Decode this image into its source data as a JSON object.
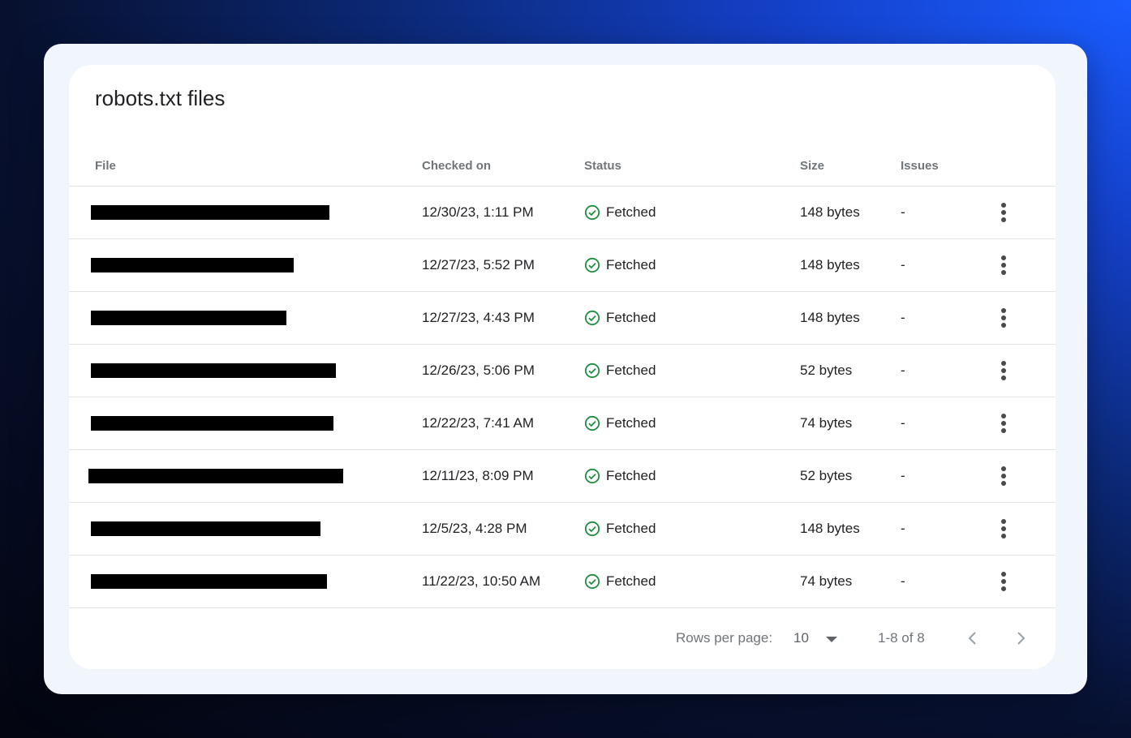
{
  "card": {
    "title": "robots.txt files"
  },
  "table": {
    "columns": {
      "file": "File",
      "checked_on": "Checked on",
      "status": "Status",
      "size": "Size",
      "issues": "Issues"
    },
    "rows": [
      {
        "checked_on": "12/30/23, 1:11 PM",
        "status": "Fetched",
        "size": "148 bytes",
        "issues": "-"
      },
      {
        "checked_on": "12/27/23, 5:52 PM",
        "status": "Fetched",
        "size": "148 bytes",
        "issues": "-"
      },
      {
        "checked_on": "12/27/23, 4:43 PM",
        "status": "Fetched",
        "size": "148 bytes",
        "issues": "-"
      },
      {
        "checked_on": "12/26/23, 5:06 PM",
        "status": "Fetched",
        "size": "52 bytes",
        "issues": "-"
      },
      {
        "checked_on": "12/22/23, 7:41 AM",
        "status": "Fetched",
        "size": "74 bytes",
        "issues": "-"
      },
      {
        "checked_on": "12/11/23, 8:09 PM",
        "status": "Fetched",
        "size": "52 bytes",
        "issues": "-"
      },
      {
        "checked_on": "12/5/23, 4:28 PM",
        "status": "Fetched",
        "size": "148 bytes",
        "issues": "-"
      },
      {
        "checked_on": "11/22/23, 10:50 AM",
        "status": "Fetched",
        "size": "74 bytes",
        "issues": "-"
      }
    ]
  },
  "pagination": {
    "rows_per_page_label": "Rows per page:",
    "rows_per_page_value": "10",
    "range": "1-8 of 8"
  },
  "icons": {
    "status": "check-circle-icon",
    "row_menu": "more-vert-icon",
    "prev": "chevron-left-icon",
    "next": "chevron-right-icon",
    "dropdown": "caret-down-icon"
  },
  "colors": {
    "status_ok": "#1e8e3e",
    "redaction": "#000000"
  }
}
